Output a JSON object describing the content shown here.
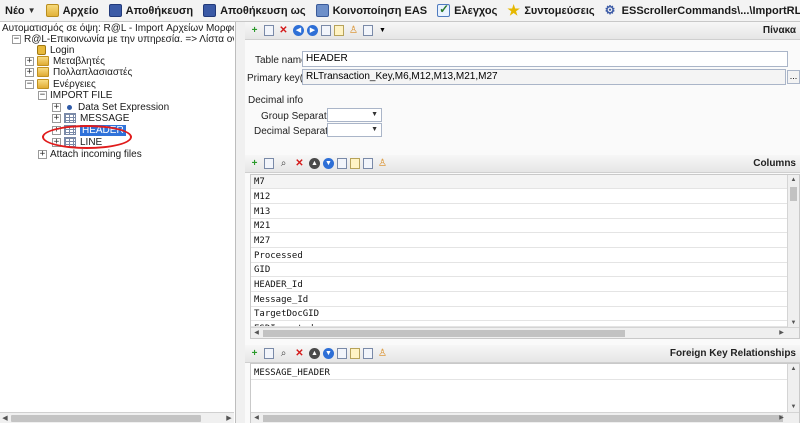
{
  "toolbar": {
    "new_label": "Νέο",
    "file_label": "Αρχείο",
    "save_label": "Αποθήκευση",
    "save_as_label": "Αποθήκευση ως",
    "share_label": "Κοινοποίηση EAS",
    "check_label": "Ελεγχος",
    "shortcuts_label": "Συντομεύσεις",
    "command_label": "ESScrollerCommands\\...\\ImportRLIncomingDocs.xm"
  },
  "tree": {
    "root": "Αυτοματισμός σε όψη: R@L - Import Αρχείων Μορφότυπου  (",
    "project": "R@L-Επικοινωνία με την υπηρεσία. => Λίστα οντοτήτ",
    "login": "Login",
    "variables": "Μεταβλητές",
    "multipliers": "Πολλαπλασιαστές",
    "actions": "Ενέργειες",
    "import_file": "IMPORT FILE",
    "dataset_expression": "Data Set Expression",
    "message": "MESSAGE",
    "header": "HEADER",
    "line": "LINE",
    "attach": "Attach incoming files"
  },
  "properties": {
    "panel_title": "Πίνακα",
    "table_name_label": "Table name",
    "table_name_value": "HEADER",
    "primary_keys_label": "Primary key(s)",
    "primary_keys_value": "RLTransaction_Key,M6,M12,M13,M21,M27",
    "decimal_info_label": "Decimal info",
    "group_separator_label": "Group Separator",
    "group_separator_value": "",
    "decimal_separator_label": "Decimal Separator",
    "decimal_separator_value": "",
    "dots_label": "..."
  },
  "columns": {
    "panel_title": "Columns",
    "rows": [
      "M7",
      "M12",
      "M13",
      "M21",
      "M27",
      "Processed",
      "GID",
      "HEADER_Id",
      "Message_Id",
      "TargetDocGID",
      "ESDImported"
    ]
  },
  "foreign_keys": {
    "panel_title": "Foreign Key Relationships",
    "rows": [
      "MESSAGE_HEADER"
    ]
  },
  "colors": {
    "selection": "#3072d9",
    "highlight_ring": "#e01b1b"
  }
}
